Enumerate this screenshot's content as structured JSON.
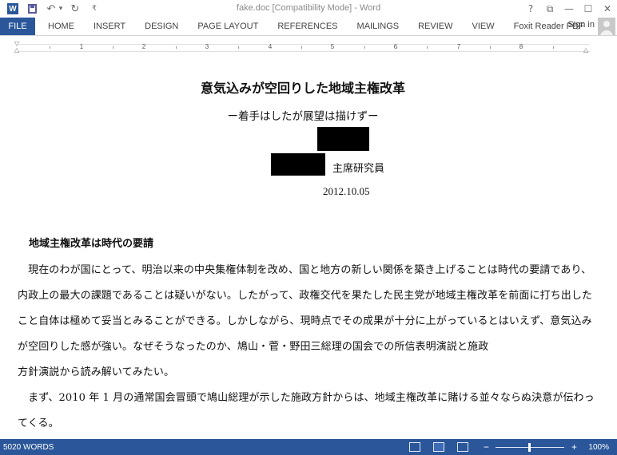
{
  "window": {
    "title": "fake.doc [Compatibility Mode] - Word",
    "help": "?",
    "restore": "⧉",
    "minimize": "—",
    "maximize": "☐",
    "close": "✕"
  },
  "qat": {
    "word_logo": "W",
    "undo": "↶",
    "undo_dropdown": "▾",
    "redo": "↻",
    "customize": "₹"
  },
  "ribbon": {
    "file": "FILE",
    "tabs": [
      "HOME",
      "INSERT",
      "DESIGN",
      "PAGE LAYOUT",
      "REFERENCES",
      "MAILINGS",
      "REVIEW",
      "VIEW",
      "Foxit Reader PDF"
    ],
    "sign_in": "Sign in"
  },
  "ruler": {
    "numbers": [
      "1",
      "2",
      "3",
      "4",
      "5",
      "6",
      "7",
      "8"
    ]
  },
  "document": {
    "title": "意気込みが空回りした地域主権改革",
    "subtitle": "ー着手はしたが展望は描けずー",
    "role": "主席研究員",
    "date": "2012.10.05",
    "heading": "地域主権改革は時代の要請",
    "lines": [
      "　現在のわが国にとって、明治以来の中央集権体制を改め、国と地方の新しい関係を築き上げることは時代の要請であり、",
      "内政上の最大の課題であることは疑いがない。したがって、政権交代を果たした民主党が地域主権改革を前面に打ち出した",
      "こと自体は極めて妥当とみることができる。しかしながら、現時点でその成果が十分に上がっているとはいえず、意気込み",
      "が空回りした感が強い。なぜそうなったのか、鳩山・菅・野田三総理の国会での所信表明演説と施政",
      "方針演説から読み解いてみたい。",
      "　まず、2010 年 1 月の通常国会冒頭で鳩山総理が示した施政方針からは、地域主権改革に賭ける並々ならぬ決意が伝わっ",
      "てくる。"
    ]
  },
  "status": {
    "word_count": "5020 WORDS",
    "zoom_minus": "−",
    "zoom_plus": "+",
    "zoom_level": "100%"
  }
}
